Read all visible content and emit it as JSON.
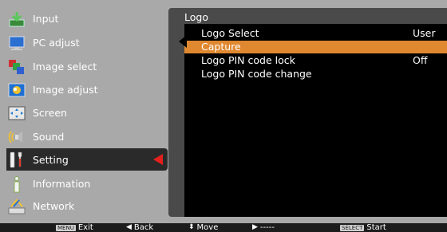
{
  "menu": {
    "items": [
      {
        "label": "Input",
        "icon": "input-icon"
      },
      {
        "label": "PC adjust",
        "icon": "monitor-icon"
      },
      {
        "label": "Image select",
        "icon": "image-select-icon"
      },
      {
        "label": "Image adjust",
        "icon": "image-adjust-icon"
      },
      {
        "label": "Screen",
        "icon": "screen-icon"
      },
      {
        "label": "Sound",
        "icon": "speaker-icon"
      },
      {
        "label": "Setting",
        "icon": "setting-icon"
      },
      {
        "label": "Information",
        "icon": "information-icon"
      },
      {
        "label": "Network",
        "icon": "network-icon"
      }
    ],
    "selected": "Setting"
  },
  "panel": {
    "title": "Logo",
    "items": [
      {
        "label": "Logo Select",
        "value": "User"
      },
      {
        "label": "Capture",
        "value": ""
      },
      {
        "label": "Logo PIN code lock",
        "value": "Off"
      },
      {
        "label": "Logo PIN code change",
        "value": ""
      }
    ],
    "highlighted": "Capture"
  },
  "footer": {
    "exit_key": "MENU",
    "exit_label": "Exit",
    "back_label": "Back",
    "move_label": "Move",
    "next_label": "-----",
    "select_key": "SELECT",
    "select_label": "Start"
  },
  "colors": {
    "background": "#a9a9a9",
    "panel": "#4a4a4a",
    "submenu": "#000000",
    "highlight": "#e08830",
    "selected_item": "#2a2a2a",
    "indicator": "#e4201c"
  }
}
